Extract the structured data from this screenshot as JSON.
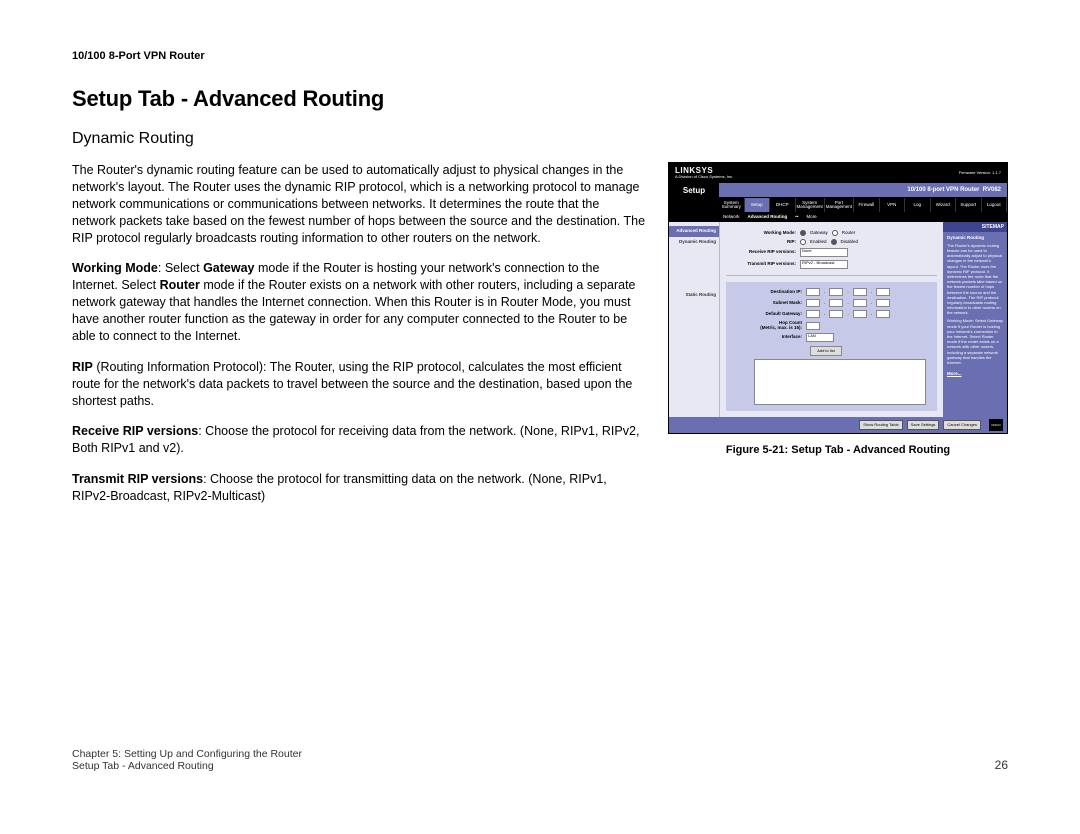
{
  "header": {
    "product": "10/100 8-Port VPN Router"
  },
  "title": "Setup Tab - Advanced Routing",
  "section": "Dynamic Routing",
  "paragraphs": {
    "intro": "The Router's dynamic routing feature can be used to automatically adjust to physical changes in the network's layout. The Router uses the dynamic RIP protocol, which is a networking protocol to manage network communications or communications between networks. It determines the route that the network packets take based on the fewest number of hops between the source and the destination. The RIP protocol regularly broadcasts routing information to other routers on the network.",
    "working_mode_label": "Working Mode",
    "working_mode_body": ": Select ",
    "gateway_word": "Gateway",
    "working_mode_body2": " mode if the Router is hosting your network's connection to the Internet. Select ",
    "router_word": "Router",
    "working_mode_body3": " mode if the Router exists on a network with other routers, including a separate network gateway that handles the Internet connection. When this Router is in Router Mode, you must have another router function as the gateway in order for any computer connected to the Router to be able to connect to the Internet.",
    "rip_label": "RIP",
    "rip_body": " (Routing Information Protocol): The Router, using the RIP protocol, calculates the most efficient route for the network's data packets to travel between the source and the destination, based upon the shortest paths.",
    "recv_label": "Receive RIP versions",
    "recv_body": ": Choose the protocol for receiving data from the network. (None, RIPv1, RIPv2, Both RIPv1 and v2).",
    "trans_label": "Transmit RIP versions",
    "trans_body": ": Choose the protocol for transmitting data on the network. (None, RIPv1, RIPv2-Broadcast, RIPv2-Multicast)"
  },
  "figure": {
    "caption": "Figure 5-21: Setup Tab - Advanced Routing"
  },
  "footer": {
    "chapter": "Chapter 5: Setting Up and Configuring the Router",
    "crumb": "Setup Tab - Advanced Routing",
    "page": "26"
  },
  "ui": {
    "brand": "LINKSYS",
    "brand_sub": "A Division of Cisco Systems, Inc.",
    "fw": "Firmware Version: 1.1.7",
    "setup_label": "Setup",
    "model": "10/100 8-port VPN Router",
    "model_code": "RV082",
    "tabs": [
      "System Summary",
      "Setup",
      "DHCP",
      "System Management",
      "Port Management",
      "Firewall",
      "VPN",
      "Log",
      "Wizard",
      "Support",
      "Logout"
    ],
    "subtabs": [
      "Network",
      "Advanced Routing",
      "••",
      "More"
    ],
    "side": {
      "hdr": "Advanced Routing",
      "dyn": "Dynamic Routing",
      "stat": "Static Routing"
    },
    "form": {
      "working_mode": "Working Mode:",
      "wm_gateway": "Gateway",
      "wm_router": "Router",
      "rip": "RIP:",
      "rip_en": "Enabled",
      "rip_dis": "Disabled",
      "recv": "Receive RIP versions:",
      "recv_val": "None",
      "trans": "Transmit RIP versions:",
      "trans_val": "RIPv2 - Broadcast",
      "dest_ip": "Destination IP:",
      "subnet": "Subnet Mask:",
      "gateway": "Default Gateway:",
      "hop": "Hop Count",
      "hop_sub": "(Metric, max. is 15):",
      "iface": "Interface:",
      "iface_val": "LAN",
      "add": "Add to list"
    },
    "footer_btns": [
      "Show Routing Table",
      "Save Settings",
      "Cancel Changes"
    ],
    "cisco": "CISCO",
    "sitemap": {
      "hdr": "SITEMAP",
      "t1": "Dynamic Routing",
      "p1": "The Router's dynamic routing feature can be used to automatically adjust to physical changes in the network's layout. The Router uses the dynamic RIP protocol. It determines the route that the network packets take based on the fewest number of hops between the source and the destination. The RIP protocol regularly broadcasts routing information to other routers on the network.",
      "t2": "Working Mode: Select Gateway mode if your Router is hosting your network's connection to the Internet. Select Router mode if the router exists on a network with other routers, including a separate network gateway that handles the Internet.",
      "more": "More..."
    }
  }
}
